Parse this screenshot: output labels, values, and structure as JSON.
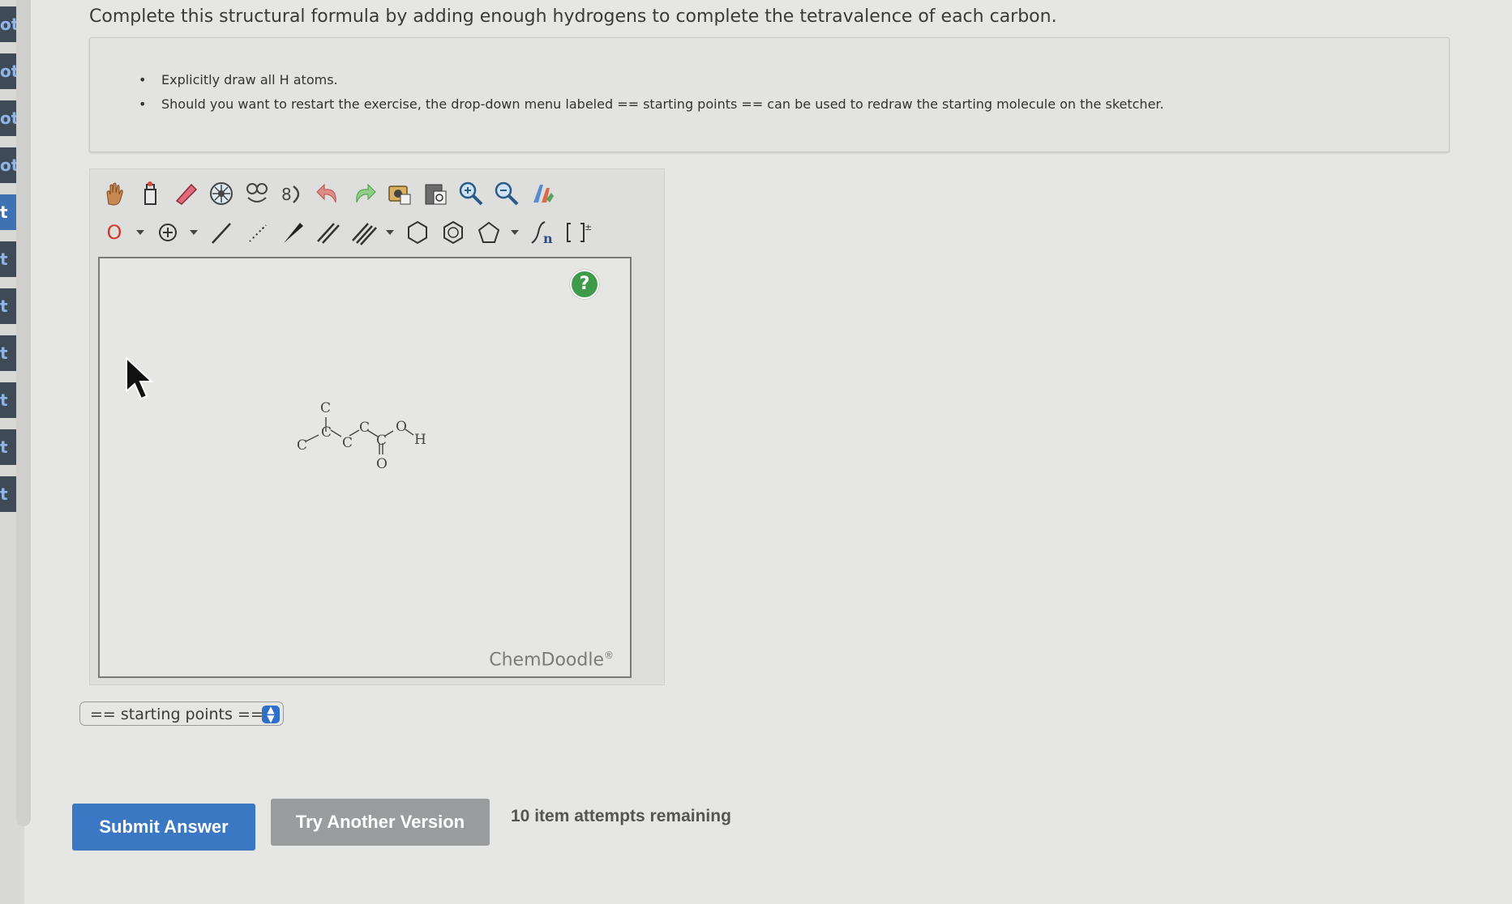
{
  "left_strip": {
    "tabs": [
      {
        "label": "ot"
      },
      {
        "label": "ot"
      },
      {
        "label": "ot"
      },
      {
        "label": "ot"
      },
      {
        "label": "t",
        "active": true
      },
      {
        "label": "t"
      },
      {
        "label": "t"
      },
      {
        "label": "t"
      },
      {
        "label": "t"
      },
      {
        "label": "t"
      },
      {
        "label": "t"
      }
    ]
  },
  "question": {
    "text": "Complete this structural formula by adding enough hydrogens to complete the tetravalence of each carbon."
  },
  "instructions": [
    "Explicitly draw all H atoms.",
    "Should you want to restart the exercise, the drop-down menu labeled == starting points == can be used to redraw the starting molecule on the sketcher."
  ],
  "sketcher": {
    "toolbar_row1": [
      "hand-icon",
      "lasso-icon",
      "eraser-icon",
      "center-icon",
      "clear-icon",
      "flip-icon",
      "undo-icon",
      "redo-icon",
      "copy-icon",
      "paste-icon",
      "zoom-in-icon",
      "zoom-out-icon",
      "clean-icon"
    ],
    "toolbar_row2": [
      "atom-label-tool",
      "charge-tool",
      "single-bond-tool",
      "hashed-bond-tool",
      "wedge-bond-tool",
      "double-bond-tool",
      "triple-bond-tool",
      "hexagon-ring-tool",
      "benzene-ring-tool",
      "pentagon-ring-tool",
      "repeat-unit-tool",
      "bracket-tool"
    ],
    "atom_label": "O",
    "help": "?",
    "brand": "ChemDoodle",
    "brand_mark": "®",
    "molecule": {
      "atoms": [
        "C",
        "C",
        "C",
        "C",
        "C",
        "C",
        "O",
        "O",
        "H"
      ]
    }
  },
  "starting_points": {
    "label": "== starting points =="
  },
  "actions": {
    "submit_label": "Submit Answer",
    "try_another_label": "Try Another Version",
    "attempts_text": "10 item attempts remaining"
  },
  "colors": {
    "submit": "#3a78c3",
    "try_another": "#9a9c9e",
    "help": "#3f9b4a",
    "select_arrows": "#2f6fc8"
  }
}
